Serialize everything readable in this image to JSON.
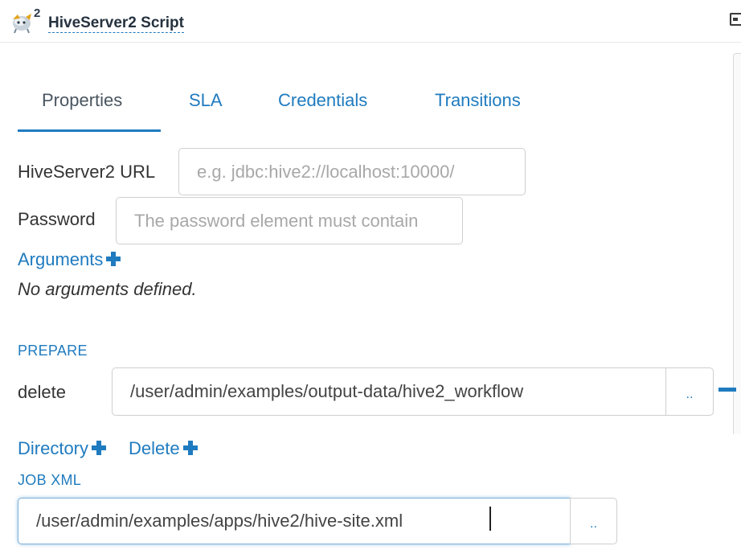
{
  "header": {
    "title": "HiveServer2 Script",
    "badge": "2",
    "logo_icon": "hive-logo-icon",
    "expand_icon": "expand-icon"
  },
  "tabs": [
    {
      "label": "Properties",
      "active": true
    },
    {
      "label": "SLA",
      "active": false
    },
    {
      "label": "Credentials",
      "active": false
    },
    {
      "label": "Transitions",
      "active": false
    }
  ],
  "fields": {
    "hiveserver2_url": {
      "label": "HiveServer2 URL",
      "value": "",
      "placeholder": "e.g. jdbc:hive2://localhost:10000/"
    },
    "password": {
      "label": "Password",
      "value": "",
      "placeholder": "The password element must contain"
    }
  },
  "arguments": {
    "label": "Arguments",
    "empty_text": "No arguments defined."
  },
  "prepare": {
    "heading": "PREPARE",
    "delete_label": "delete",
    "delete_value": "/user/admin/examples/output-data/hive2_workflow",
    "browse_label": "..",
    "add_directory": "Directory",
    "add_delete": "Delete"
  },
  "job_xml": {
    "heading": "JOB XML",
    "value": "/user/admin/examples/apps/hive2/hive-site.xml",
    "browse_label": ".."
  },
  "colors": {
    "accent": "#1f7bbf",
    "text": "#333333",
    "placeholder": "#a8a8a8"
  }
}
